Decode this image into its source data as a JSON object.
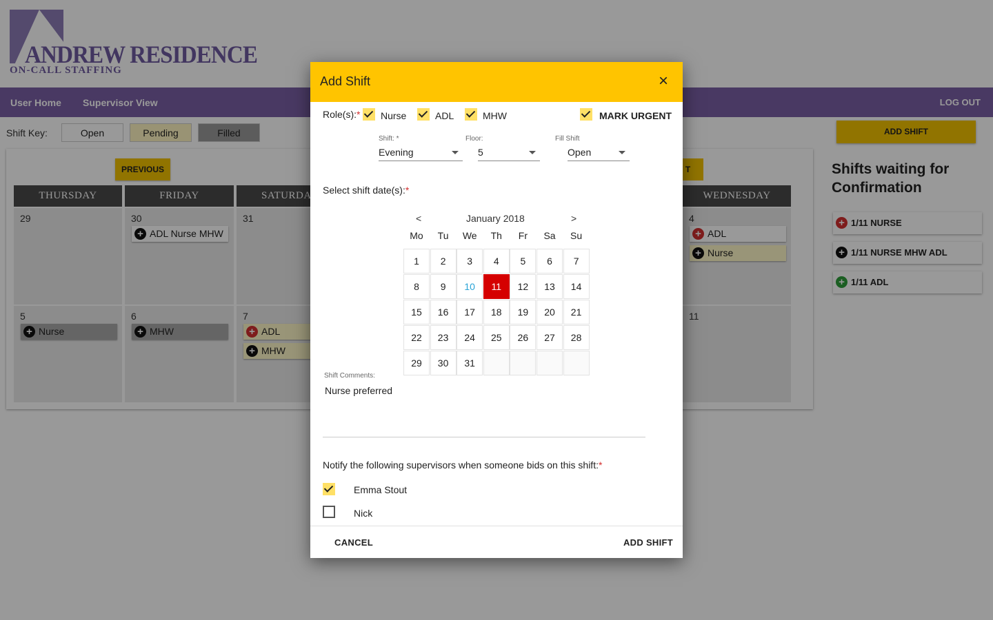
{
  "brand": {
    "name": "ANDREW RESIDENCE",
    "subtitle": "ON-CALL STAFFING"
  },
  "nav": {
    "user_home": "User Home",
    "supervisor_view": "Supervisor View",
    "logout": "LOG OUT"
  },
  "shift_key": {
    "label": "Shift Key:",
    "open": "Open",
    "pending": "Pending",
    "filled": "Filled"
  },
  "calendar": {
    "previous": "PREVIOUS",
    "next_fragment": "T",
    "days": [
      "THURSDAY",
      "FRIDAY",
      "SATURDA",
      "WEDNESDAY"
    ],
    "cells": {
      "c1": {
        "num": "29"
      },
      "c2": {
        "num": "30",
        "chip": "ADL Nurse MHW"
      },
      "c3": {
        "num": "31"
      },
      "c4": {
        "num": "4",
        "chip1": "ADL",
        "chip2": "Nurse"
      },
      "c5": {
        "num": "5",
        "chip": "Nurse"
      },
      "c6": {
        "num": "6",
        "chip": "MHW"
      },
      "c7": {
        "num": "7",
        "chip1": "ADL",
        "chip2": "MHW"
      },
      "c8": {
        "num": "11"
      }
    }
  },
  "sidebar": {
    "add_shift": "ADD SHIFT",
    "waiting_title": "Shifts waiting for Confirmation",
    "items": [
      {
        "label": "1/11 NURSE",
        "status": "urgent"
      },
      {
        "label": "1/11 NURSE MHW ADL",
        "status": "normal"
      },
      {
        "label": "1/11 ADL",
        "status": "confirmed"
      }
    ]
  },
  "modal": {
    "title": "Add Shift",
    "close": "×",
    "roles_label": "Role(s):",
    "required_mark": "*",
    "roles": [
      {
        "label": "Nurse",
        "checked": true
      },
      {
        "label": "ADL",
        "checked": true
      },
      {
        "label": "MHW",
        "checked": true
      }
    ],
    "mark_urgent": {
      "label": "MARK URGENT",
      "checked": true
    },
    "shift": {
      "caption": "Shift:",
      "required": "*",
      "value": "Evening"
    },
    "floor": {
      "caption": "Floor:",
      "value": "5"
    },
    "fill": {
      "caption": "Fill Shift",
      "value": "Open"
    },
    "dates_label": "Select shift date(s):",
    "datepicker": {
      "prev": "<",
      "next": ">",
      "month": "January 2018",
      "weekdays": [
        "Mo",
        "Tu",
        "We",
        "Th",
        "Fr",
        "Sa",
        "Su"
      ],
      "weeks": [
        [
          "1",
          "2",
          "3",
          "4",
          "5",
          "6",
          "7"
        ],
        [
          "8",
          "9",
          "10",
          "11",
          "12",
          "13",
          "14"
        ],
        [
          "15",
          "16",
          "17",
          "18",
          "19",
          "20",
          "21"
        ],
        [
          "22",
          "23",
          "24",
          "25",
          "26",
          "27",
          "28"
        ],
        [
          "29",
          "30",
          "31",
          "",
          "",
          "",
          ""
        ]
      ],
      "today": "10",
      "selected": "11"
    },
    "comments": {
      "caption": "Shift Comments:",
      "value": "Nurse preferred"
    },
    "notify_label": "Notify the following supervisors when someone bids on this shift:",
    "supervisors": [
      {
        "name": "Emma Stout",
        "checked": true
      },
      {
        "name": "Nick",
        "checked": false
      }
    ],
    "cancel": "CANCEL",
    "submit": "ADD SHIFT"
  },
  "colors": {
    "accent": "#ffc400",
    "nav": "#7b5fa6",
    "urgent": "#d32f2f",
    "selected_date": "#d50000",
    "today": "#29a3d6"
  }
}
